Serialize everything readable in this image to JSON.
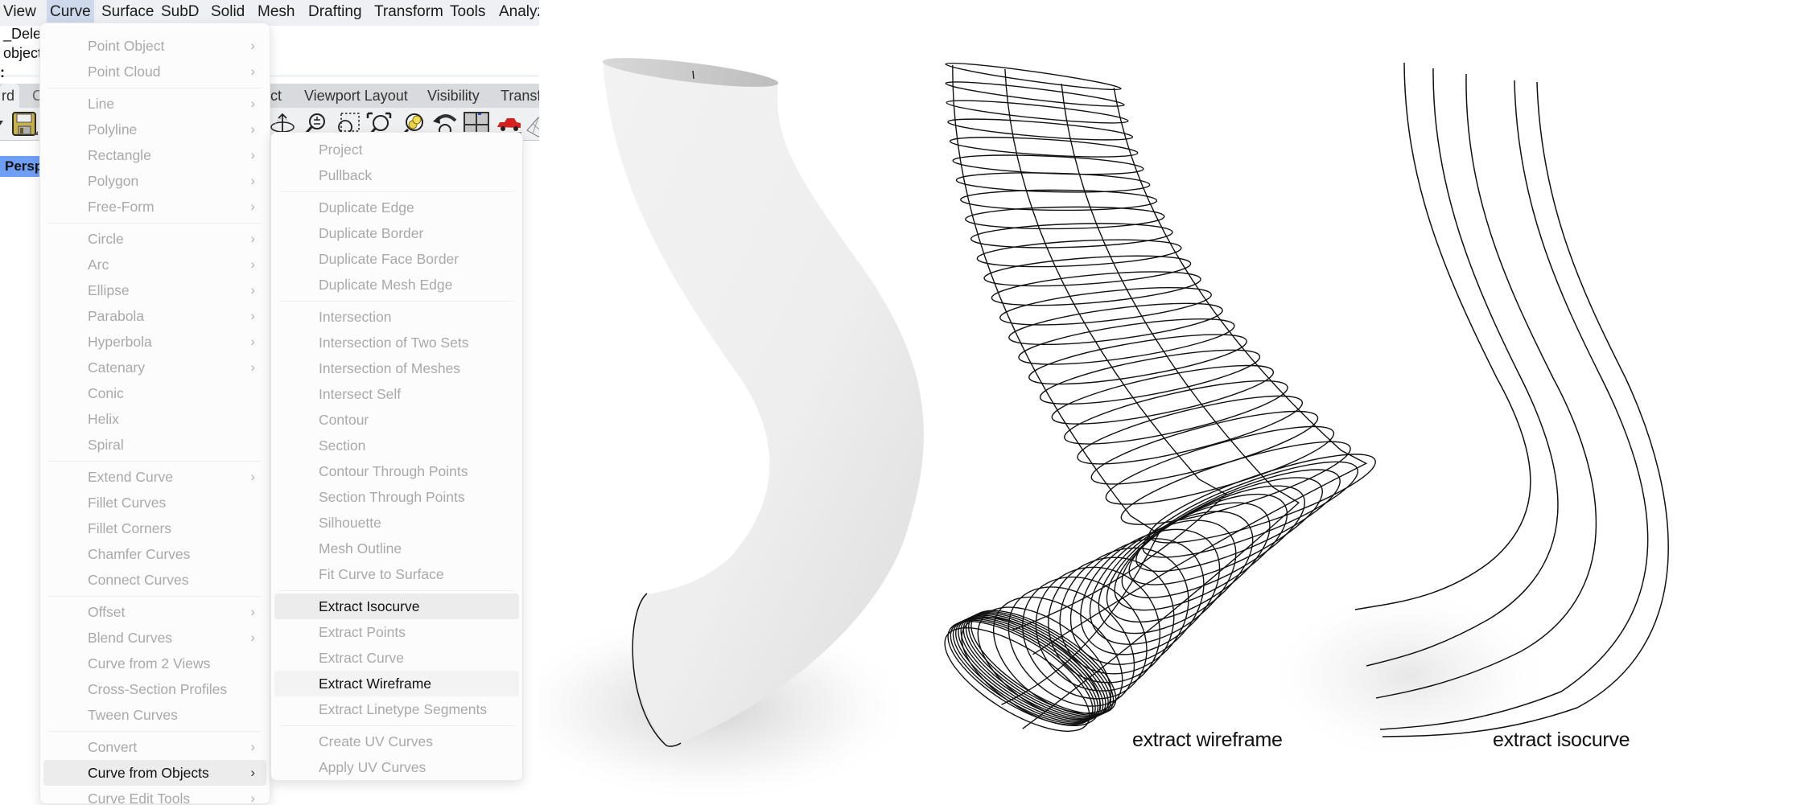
{
  "menubar": {
    "items": [
      {
        "label": "View"
      },
      {
        "label": "Curve",
        "active": true
      },
      {
        "label": "Surface"
      },
      {
        "label": "SubD"
      },
      {
        "label": "Solid"
      },
      {
        "label": "Mesh"
      },
      {
        "label": "Drafting"
      },
      {
        "label": "Transform"
      },
      {
        "label": "Tools"
      },
      {
        "label": "Analyz"
      }
    ]
  },
  "command_history": {
    "lines": [
      "_Delet",
      "object"
    ],
    "prompt": ":"
  },
  "toolbar_tabs": {
    "items": [
      {
        "label": "rd",
        "selected": true
      },
      {
        "label": "C"
      },
      {
        "label": "ct"
      },
      {
        "label": "Viewport Layout"
      },
      {
        "label": "Visibility"
      },
      {
        "label": "Transfo"
      }
    ]
  },
  "toolbar_icons": [
    "save-icon",
    "rotate-view-icon",
    "zoom-in-out-icon",
    "zoom-window-icon",
    "zoom-extents-icon",
    "zoom-selected-icon",
    "undo-view-change-icon",
    "four-viewports-icon",
    "render-car-icon",
    "mesh-plane-icon"
  ],
  "viewport": {
    "label": "Persp"
  },
  "curve_menu": {
    "items": [
      {
        "label": "Point Object",
        "submenu": true
      },
      {
        "label": "Point Cloud",
        "submenu": true
      },
      {
        "separator": true
      },
      {
        "label": "Line",
        "submenu": true
      },
      {
        "label": "Polyline",
        "submenu": true
      },
      {
        "label": "Rectangle",
        "submenu": true
      },
      {
        "label": "Polygon",
        "submenu": true
      },
      {
        "label": "Free-Form",
        "submenu": true
      },
      {
        "separator": true
      },
      {
        "label": "Circle",
        "submenu": true
      },
      {
        "label": "Arc",
        "submenu": true
      },
      {
        "label": "Ellipse",
        "submenu": true
      },
      {
        "label": "Parabola",
        "submenu": true
      },
      {
        "label": "Hyperbola",
        "submenu": true
      },
      {
        "label": "Catenary",
        "submenu": true
      },
      {
        "label": "Conic"
      },
      {
        "label": "Helix"
      },
      {
        "label": "Spiral"
      },
      {
        "separator": true
      },
      {
        "label": "Extend Curve",
        "submenu": true
      },
      {
        "label": "Fillet Curves"
      },
      {
        "label": "Fillet Corners"
      },
      {
        "label": "Chamfer Curves"
      },
      {
        "label": "Connect Curves"
      },
      {
        "separator": true
      },
      {
        "label": "Offset",
        "submenu": true
      },
      {
        "label": "Blend Curves",
        "submenu": true
      },
      {
        "label": "Curve from 2 Views"
      },
      {
        "label": "Cross-Section Profiles"
      },
      {
        "label": "Tween Curves"
      },
      {
        "separator": true
      },
      {
        "label": "Convert",
        "submenu": true
      },
      {
        "label": "Curve from Objects",
        "submenu": true,
        "enabled": true,
        "highlighted": true
      },
      {
        "label": "Curve Edit Tools",
        "submenu": true
      }
    ]
  },
  "curve_from_objects_submenu": {
    "items": [
      {
        "label": "Project"
      },
      {
        "label": "Pullback"
      },
      {
        "separator": true
      },
      {
        "label": "Duplicate Edge"
      },
      {
        "label": "Duplicate Border"
      },
      {
        "label": "Duplicate Face Border"
      },
      {
        "label": "Duplicate Mesh Edge"
      },
      {
        "separator": true
      },
      {
        "label": "Intersection"
      },
      {
        "label": "Intersection of Two Sets"
      },
      {
        "label": "Intersection of Meshes"
      },
      {
        "label": "Intersect Self"
      },
      {
        "label": "Contour"
      },
      {
        "label": "Section"
      },
      {
        "label": "Contour Through Points"
      },
      {
        "label": "Section Through Points"
      },
      {
        "label": "Silhouette"
      },
      {
        "label": "Mesh Outline"
      },
      {
        "label": "Fit Curve to Surface"
      },
      {
        "separator": true
      },
      {
        "label": "Extract Isocurve",
        "enabled": true,
        "highlighted": true
      },
      {
        "label": "Extract Points"
      },
      {
        "label": "Extract Curve"
      },
      {
        "label": "Extract Wireframe",
        "enabled": true,
        "highlighted_light": true
      },
      {
        "label": "Extract Linetype Segments"
      },
      {
        "separator": true
      },
      {
        "label": "Create UV Curves"
      },
      {
        "label": "Apply UV Curves"
      }
    ]
  },
  "illustration": {
    "panels": [
      {
        "name": "rendered-surface",
        "caption": ""
      },
      {
        "name": "wireframe",
        "caption": "extract wireframe"
      },
      {
        "name": "isocurves",
        "caption": "extract isocurve"
      }
    ]
  }
}
